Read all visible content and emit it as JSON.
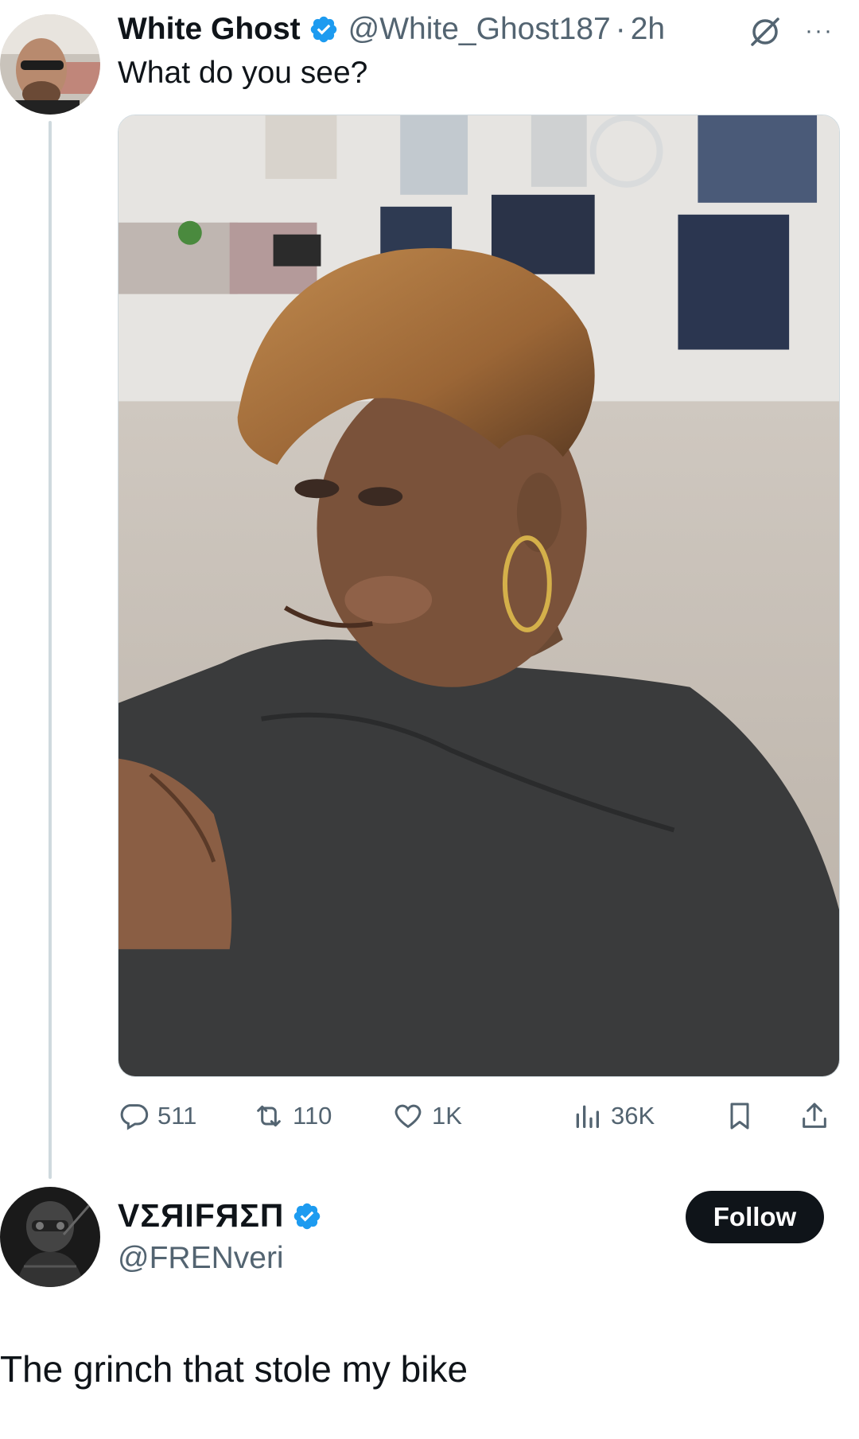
{
  "tweet": {
    "author_name": "White Ghost",
    "handle": "@White_Ghost187",
    "separator": "·",
    "time": "2h",
    "text": "What do you see?",
    "more_label": "···"
  },
  "actions": {
    "replies": "511",
    "reposts": "110",
    "likes": "1K",
    "views": "36K"
  },
  "reply": {
    "author_name": "VΣЯIFЯΣП",
    "handle": "@FRENveri",
    "follow_label": "Follow",
    "text": "The grinch that stole my bike"
  },
  "colors": {
    "verified": "#1d9bf0",
    "muted": "#536471",
    "text": "#0f1419",
    "follow_bg": "#0f1419",
    "divider": "#cfd9de"
  },
  "icons": [
    "verified-badge-icon",
    "grok-icon",
    "more-icon",
    "reply-icon",
    "repost-icon",
    "like-icon",
    "views-icon",
    "bookmark-icon",
    "share-icon"
  ]
}
